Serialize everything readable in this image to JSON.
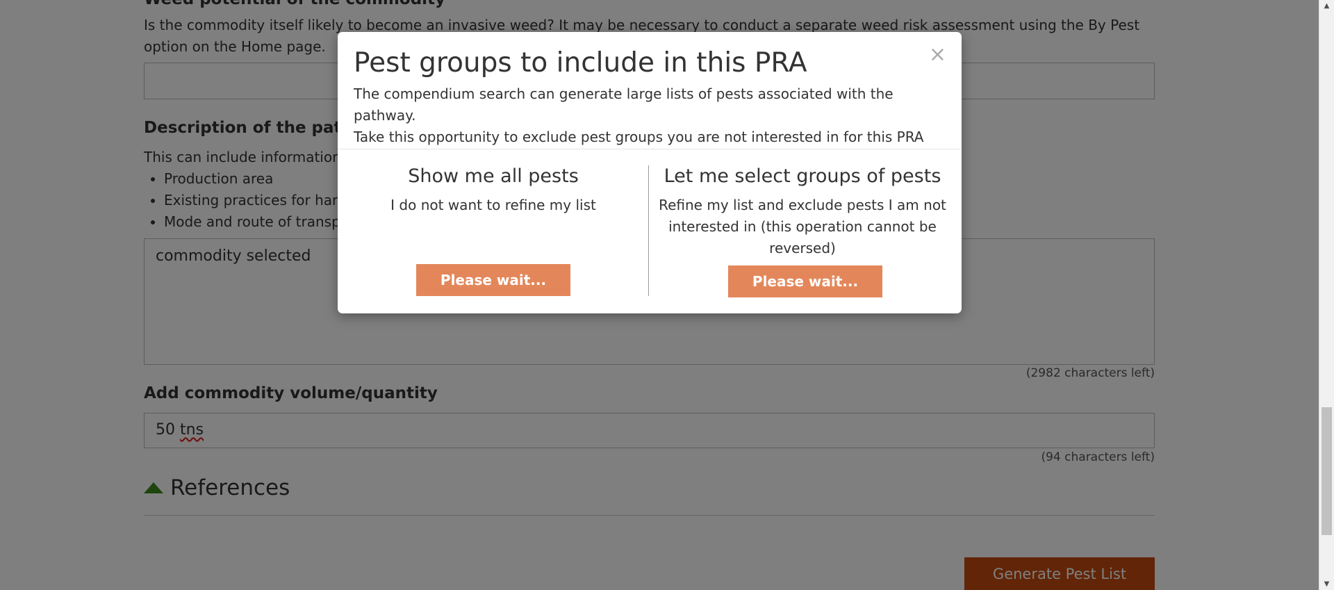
{
  "background": {
    "weed_heading": "Weed potential of the commodity",
    "weed_help": "Is the commodity itself likely to become an invasive weed? It may be necessary to conduct a separate weed risk assessment using the By Pest option on the Home page.",
    "weed_value": "",
    "pathway_heading": "Description of the pathway",
    "pathway_help": "This can include information",
    "pathway_bullets": [
      "Production area",
      "Existing practices for harvest",
      "Mode and route of transport"
    ],
    "pathway_value": "commodity selected",
    "pathway_counter": "(2982 characters left)",
    "volume_heading": "Add commodity volume/quantity",
    "volume_value_number": "50",
    "volume_value_unit": "tns",
    "volume_counter": "(94 characters left)",
    "references_label": "References",
    "generate_button": "Generate Pest List"
  },
  "modal": {
    "close_glyph": "×",
    "title": "Pest groups to include in this PRA",
    "intro_line1": "The compendium search can generate large lists of pests associated with the pathway.",
    "intro_line2": "Take this opportunity to exclude pest groups you are not interested in for this PRA",
    "left": {
      "heading": "Show me all pests",
      "text": "I do not want to refine my list",
      "button": "Please wait..."
    },
    "right": {
      "heading": "Let me select groups of pests",
      "text": "Refine my list and exclude pests I am not interested in (this operation cannot be reversed)",
      "button": "Please wait..."
    }
  },
  "icons": {
    "references_toggle": "triangle-up-icon",
    "scroll_up": "chevron-up-icon",
    "scroll_down": "chevron-down-icon",
    "close": "close-icon"
  },
  "colors": {
    "overlay": "#000000",
    "wait_button": "#e3875a",
    "generate_button": "#c44a0e",
    "references_triangle": "#3b8a1a"
  }
}
